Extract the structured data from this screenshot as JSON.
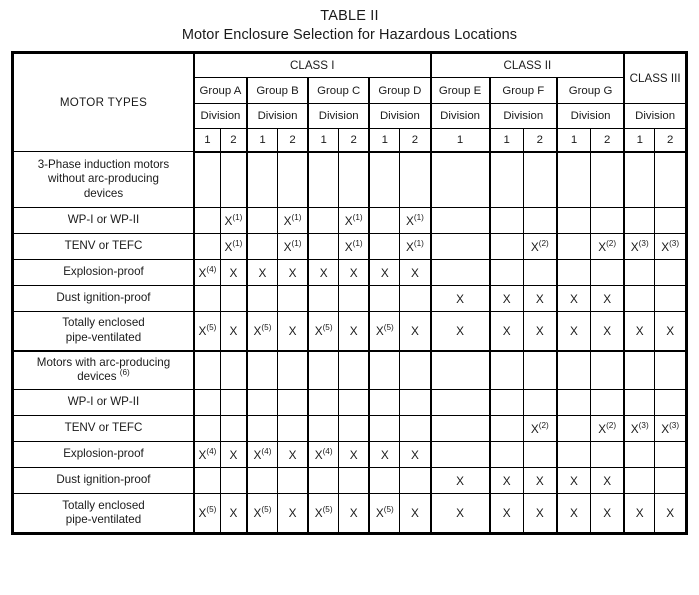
{
  "title": {
    "line1": "TABLE II",
    "line2": "Motor Enclosure Selection for Hazardous Locations"
  },
  "header": {
    "motor_types": "MOTOR TYPES",
    "classes": [
      {
        "label": "CLASS I",
        "span": 8
      },
      {
        "label": "CLASS II",
        "span": 5
      },
      {
        "label": "CLASS III",
        "span": 2
      }
    ],
    "groups": [
      {
        "label": "Group A",
        "span": 2
      },
      {
        "label": "Group B",
        "span": 2
      },
      {
        "label": "Group C",
        "span": 2
      },
      {
        "label": "Group D",
        "span": 2
      },
      {
        "label": "Group E",
        "span": 1
      },
      {
        "label": "Group F",
        "span": 2
      },
      {
        "label": "Group G",
        "span": 2
      }
    ],
    "division_label": "Division",
    "divisions": [
      {
        "label": "1"
      },
      {
        "label": "2"
      },
      {
        "label": "1"
      },
      {
        "label": "2"
      },
      {
        "label": "1"
      },
      {
        "label": "2"
      },
      {
        "label": "1"
      },
      {
        "label": "2"
      },
      {
        "label": "1"
      },
      {
        "label": "1"
      },
      {
        "label": "2"
      },
      {
        "label": "1"
      },
      {
        "label": "2"
      },
      {
        "label": "1"
      },
      {
        "label": "2"
      }
    ]
  },
  "columns": [
    "Class I Group A Div 1",
    "Class I Group A Div 2",
    "Class I Group B Div 1",
    "Class I Group B Div 2",
    "Class I Group C Div 1",
    "Class I Group C Div 2",
    "Class I Group D Div 1",
    "Class I Group D Div 2",
    "Class II Group E Div 1",
    "Class II Group F Div 1",
    "Class II Group F Div 2",
    "Class II Group G Div 1",
    "Class II Group G Div 2",
    "Class III Div 1",
    "Class III Div 2"
  ],
  "rows": [
    {
      "label": "3-Phase induction motors without arc-producing devices",
      "label_lines": [
        "3-Phase induction motors",
        "without arc-producing",
        "devices"
      ],
      "section_head": true,
      "height": "tall3",
      "cells": [
        "",
        "",
        "",
        "",
        "",
        "",
        "",
        "",
        "",
        "",
        "",
        "",
        "",
        "",
        ""
      ]
    },
    {
      "label": "WP-I or WP-II",
      "label_lines": [
        "WP-I or WP-II"
      ],
      "height": "norm",
      "cells": [
        "",
        "X(1)",
        "",
        "X(1)",
        "",
        "X(1)",
        "",
        "X(1)",
        "",
        "",
        "",
        "",
        "",
        "",
        ""
      ]
    },
    {
      "label": "TENV or TEFC",
      "label_lines": [
        "TENV or TEFC"
      ],
      "height": "norm",
      "cells": [
        "",
        "X(1)",
        "",
        "X(1)",
        "",
        "X(1)",
        "",
        "X(1)",
        "",
        "",
        "X(2)",
        "",
        "X(2)",
        "X(3)",
        "X(3)"
      ]
    },
    {
      "label": "Explosion-proof",
      "label_lines": [
        "Explosion-proof"
      ],
      "height": "norm",
      "cells": [
        "X(4)",
        "X",
        "X",
        "X",
        "X",
        "X",
        "X",
        "X",
        "",
        "",
        "",
        "",
        "",
        "",
        ""
      ]
    },
    {
      "label": "Dust ignition-proof",
      "label_lines": [
        "Dust ignition-proof"
      ],
      "height": "norm",
      "cells": [
        "",
        "",
        "",
        "",
        "",
        "",
        "",
        "",
        "X",
        "X",
        "X",
        "X",
        "X",
        "",
        ""
      ]
    },
    {
      "label": "Totally enclosed pipe-ventilated",
      "label_lines": [
        "Totally enclosed",
        "pipe-ventilated"
      ],
      "height": "tall2",
      "section_end": true,
      "cells": [
        "X(5)",
        "X",
        "X(5)",
        "X",
        "X(5)",
        "X",
        "X(5)",
        "X",
        "X",
        "X",
        "X",
        "X",
        "X",
        "X",
        "X"
      ]
    },
    {
      "label": "Motors with arc-producing devices (6)",
      "label_lines": [
        "Motors with arc-producing",
        "devices (6)"
      ],
      "label_sup": "(6)",
      "section_head": true,
      "height": "tall2",
      "cells": [
        "",
        "",
        "",
        "",
        "",
        "",
        "",
        "",
        "",
        "",
        "",
        "",
        "",
        "",
        ""
      ]
    },
    {
      "label": "WP-I or WP-II",
      "label_lines": [
        "WP-I or WP-II"
      ],
      "height": "norm",
      "cells": [
        "",
        "",
        "",
        "",
        "",
        "",
        "",
        "",
        "",
        "",
        "",
        "",
        "",
        "",
        ""
      ]
    },
    {
      "label": "TENV or TEFC",
      "label_lines": [
        "TENV or TEFC"
      ],
      "height": "norm",
      "cells": [
        "",
        "",
        "",
        "",
        "",
        "",
        "",
        "",
        "",
        "",
        "X(2)",
        "",
        "X(2)",
        "X(3)",
        "X(3)"
      ]
    },
    {
      "label": "Explosion-proof",
      "label_lines": [
        "Explosion-proof"
      ],
      "height": "norm",
      "cells": [
        "X(4)",
        "X",
        "X(4)",
        "X",
        "X(4)",
        "X",
        "X",
        "X",
        "",
        "",
        "",
        "",
        "",
        "",
        ""
      ]
    },
    {
      "label": "Dust ignition-proof",
      "label_lines": [
        "Dust ignition-proof"
      ],
      "height": "norm",
      "cells": [
        "",
        "",
        "",
        "",
        "",
        "",
        "",
        "",
        "X",
        "X",
        "X",
        "X",
        "X",
        "",
        ""
      ]
    },
    {
      "label": "Totally enclosed pipe-ventilated",
      "label_lines": [
        "Totally enclosed",
        "pipe-ventilated"
      ],
      "height": "tall2",
      "cells": [
        "X(5)",
        "X",
        "X(5)",
        "X",
        "X(5)",
        "X",
        "X(5)",
        "X",
        "X",
        "X",
        "X",
        "X",
        "X",
        "X",
        "X"
      ]
    }
  ],
  "colors": {
    "border": "#000000",
    "text": "#1a1a1a",
    "background": "#ffffff"
  }
}
